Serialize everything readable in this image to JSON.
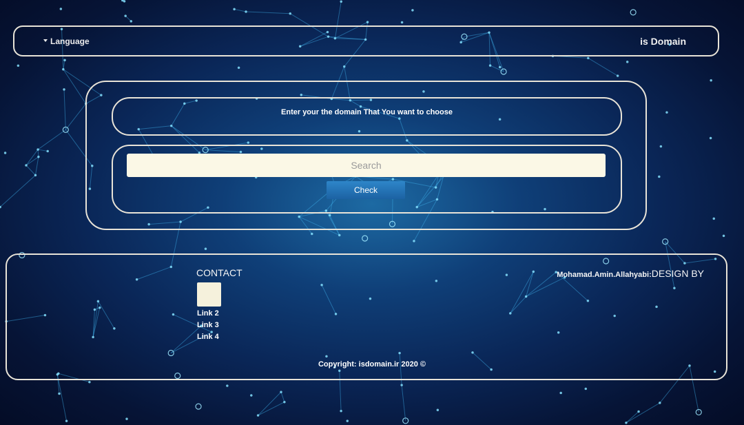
{
  "header": {
    "language_label": "Language",
    "brand": "is Domain"
  },
  "search": {
    "prompt": "Enter your the domain That You want to choose",
    "placeholder": "Search",
    "button_label": "Check"
  },
  "footer": {
    "contact_title": "CONTACT",
    "links": [
      "Link 2",
      "Link 3",
      "Link 4"
    ],
    "designer_name": "Mohamad.Amin.Allahyabi:",
    "designer_label": "DESIGN BY",
    "copyright": "Copyright: isdomain.ir 2020 ©"
  },
  "colors": {
    "frame": "#e9e4d8",
    "input_background": "#fbf8e6",
    "button": "#1f6fb2",
    "background_dark": "#061436",
    "background_glow": "#1d6aa3"
  }
}
